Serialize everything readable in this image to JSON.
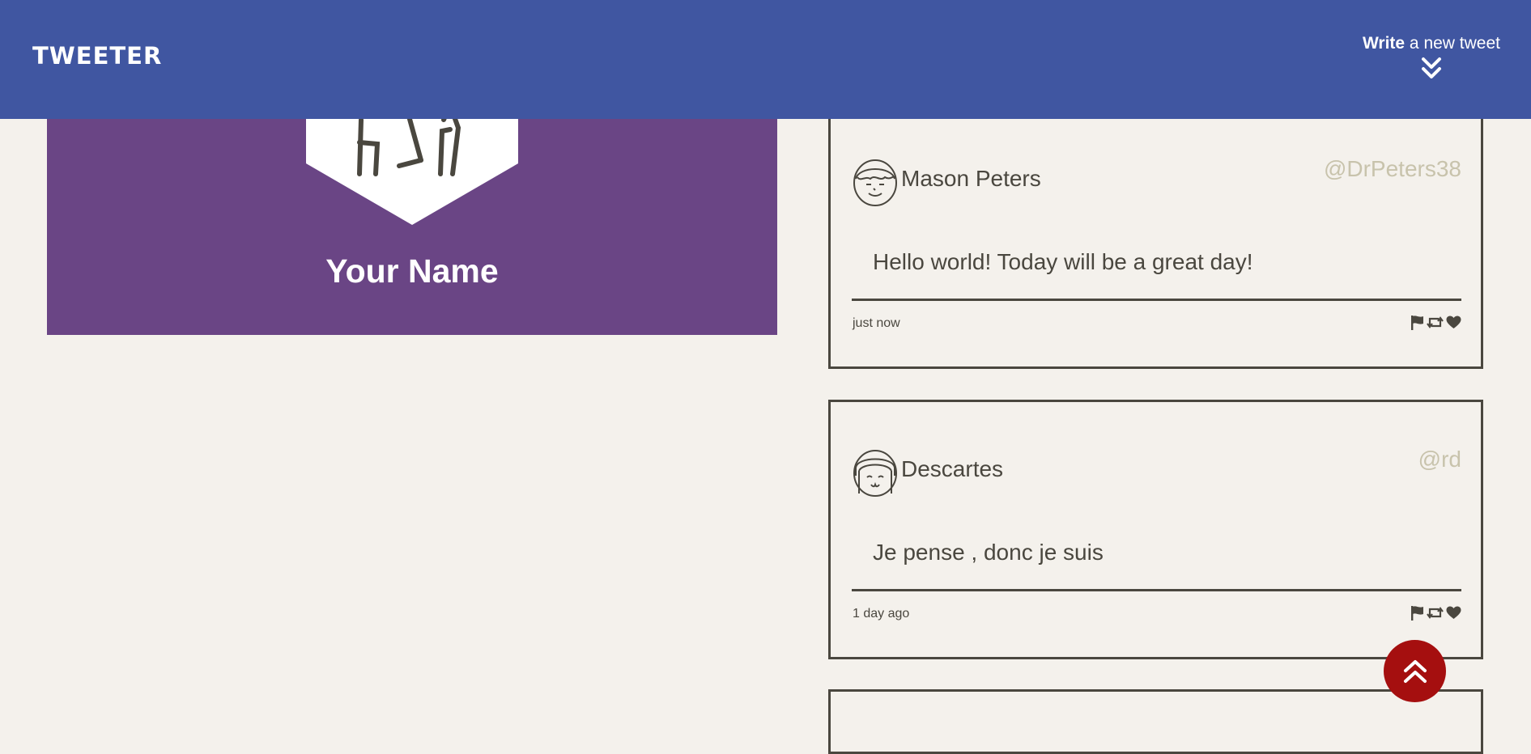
{
  "nav": {
    "logo": "TWEETER",
    "compose_bold": "Write",
    "compose_rest": " a new tweet",
    "compose_icon": "double-chevron-down-icon",
    "background": "#4056a1"
  },
  "profile": {
    "name": "Your Name",
    "background": "#6a4585"
  },
  "tweets": [
    {
      "name": "Mason Peters",
      "handle": "@DrPeters38",
      "text": "Hello world! Today will be a great day!",
      "time": "just now"
    },
    {
      "name": "Descartes",
      "handle": "@rd",
      "text": "Je pense , donc je suis",
      "time": "1 day ago"
    }
  ],
  "tweet_actions": [
    "flag-icon",
    "retweet-icon",
    "heart-icon"
  ],
  "scroll_top": {
    "icon": "double-chevron-up-icon",
    "color": "#a50f0f"
  }
}
